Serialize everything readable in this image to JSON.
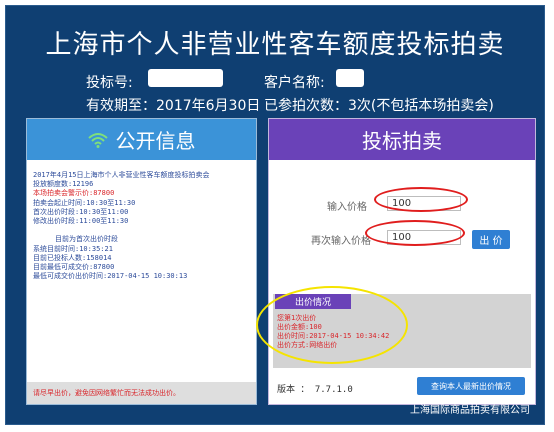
{
  "page": {
    "title": "上海市个人非营业性客车额度投标拍卖",
    "bid_number_label": "投标号:",
    "customer_name_label": "客户名称:",
    "valid_until": "有效期至：2017年6月30日",
    "auction_count": "已参拍次数：3次(不包括本场拍卖会)",
    "company": "上海国际商品拍卖有限公司"
  },
  "left": {
    "header": "公开信息",
    "header_icon": "wifi-icon",
    "lines": [
      {
        "text": "2017年4月15日上海市个人非营业性客车额度投标拍卖会",
        "style": "normal"
      },
      {
        "text": "投放额度数:12196",
        "style": "normal"
      },
      {
        "text": "本场拍卖会警示价:87800",
        "style": "red"
      },
      {
        "text": "拍卖会起止时间:10:30至11:30",
        "style": "normal"
      },
      {
        "text": "首次出价时段:10:30至11:00",
        "style": "normal"
      },
      {
        "text": "修改出价时段:11:00至11:30",
        "style": "normal"
      },
      {
        "text": "",
        "style": "normal"
      },
      {
        "text": "目前为首次出价时段",
        "style": "center"
      },
      {
        "text": "系统目前时间:10:35:21",
        "style": "normal"
      },
      {
        "text": "目前已投标人数:158014",
        "style": "normal"
      },
      {
        "text": "目前最低可成交价:87800",
        "style": "normal"
      },
      {
        "text": "最低可成交价出价时间:2017-04-15 10:30:13",
        "style": "normal"
      }
    ],
    "warning": "请尽早出价，避免因网络繁忙而无法成功出价。"
  },
  "right": {
    "header": "投标拍卖",
    "price_label": "输入价格",
    "price_value": "100",
    "repeat_label": "再次输入价格",
    "repeat_value": "100",
    "bid_button": "出 价",
    "status_label": "出价情况",
    "status_lines": [
      "您第1次出价",
      "出价金额:100",
      "出价时间:2017-04-15 10:34:42",
      "出价方式:网络出价"
    ],
    "version": "版本 ： 7.7.1.0",
    "query_button": "查询本人最新出价情况"
  },
  "colors": {
    "background": "#0f3f72",
    "left_header": "#3b93d8",
    "right_header": "#6a42b8",
    "button": "#2f7fd3",
    "warning_text": "#d9262b",
    "annotation_red": "#e01d1d",
    "annotation_yellow": "#f5e400"
  }
}
